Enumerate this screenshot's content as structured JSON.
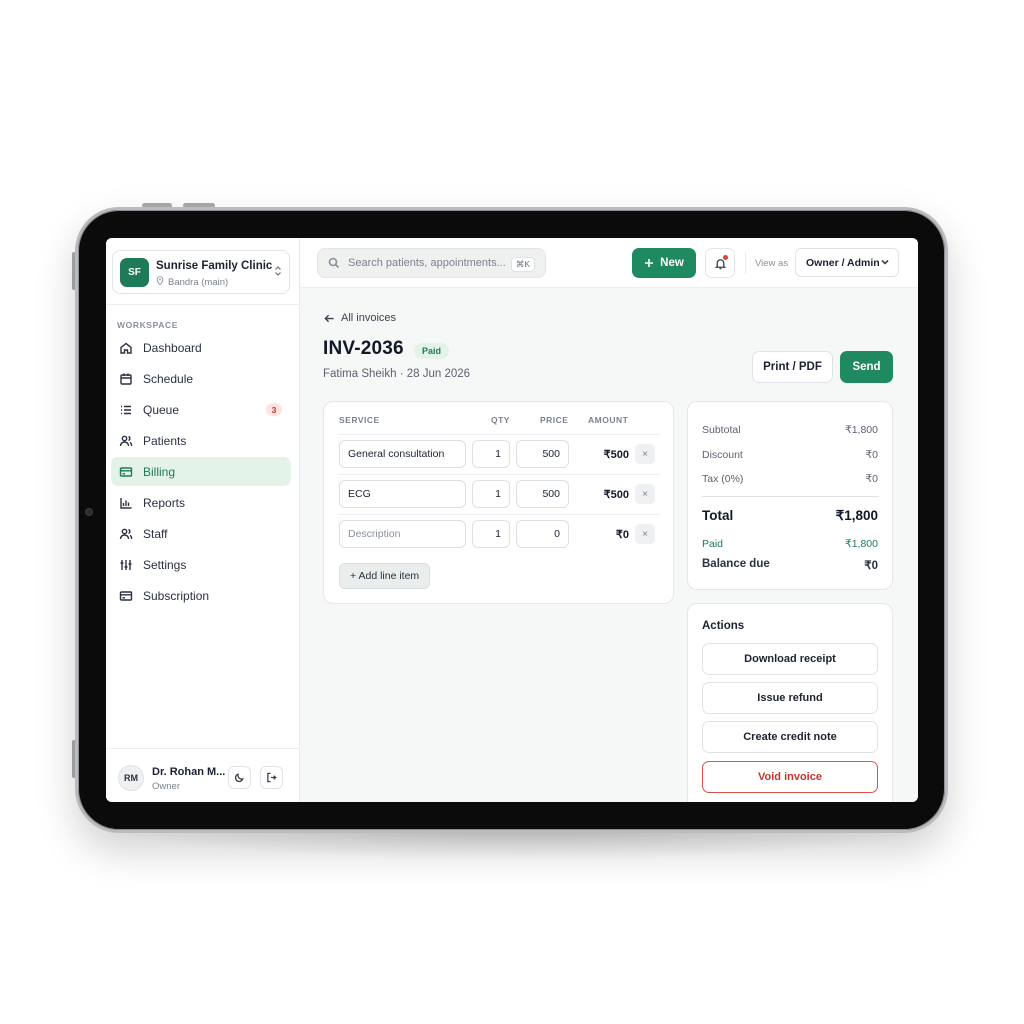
{
  "org": {
    "initials": "SF",
    "name": "Sunrise Family Clinic",
    "location": "Bandra (main)"
  },
  "sidebar": {
    "section_label": "WORKSPACE",
    "items": [
      {
        "label": "Dashboard",
        "icon": "home-icon"
      },
      {
        "label": "Schedule",
        "icon": "calendar-icon"
      },
      {
        "label": "Queue",
        "icon": "list-icon",
        "badge": "3"
      },
      {
        "label": "Patients",
        "icon": "users-icon"
      },
      {
        "label": "Billing",
        "icon": "credit-card-icon",
        "active": true
      },
      {
        "label": "Reports",
        "icon": "bar-chart-icon"
      },
      {
        "label": "Staff",
        "icon": "user-group-icon"
      },
      {
        "label": "Settings",
        "icon": "sliders-icon"
      },
      {
        "label": "Subscription",
        "icon": "card-icon"
      }
    ]
  },
  "user": {
    "initials": "RM",
    "name": "Dr. Rohan M...",
    "role": "Owner"
  },
  "topbar": {
    "search_placeholder": "Search patients, appointments...",
    "search_shortcut": "⌘K",
    "new_label": "New",
    "view_as_label": "View as",
    "view_as_value": "Owner / Admin"
  },
  "invoice": {
    "back_label": "All invoices",
    "number": "INV-2036",
    "status": "Paid",
    "subtitle": "Fatima Sheikh · 28 Jun 2026",
    "print_label": "Print / PDF",
    "send_label": "Send",
    "columns": {
      "service": "SERVICE",
      "qty": "QTY",
      "price": "PRICE",
      "amount": "AMOUNT"
    },
    "lines": [
      {
        "service": "General consultation",
        "qty": "1",
        "price": "500",
        "amount": "₹500"
      },
      {
        "service": "ECG",
        "qty": "1",
        "price": "500",
        "amount": "₹500"
      },
      {
        "service_placeholder": "Description",
        "qty": "1",
        "price": "0",
        "amount": "₹0"
      }
    ],
    "add_line_label": "+ Add line item",
    "remove_glyph": "×"
  },
  "totals": {
    "subtotal_label": "Subtotal",
    "subtotal": "₹1,800",
    "discount_label": "Discount",
    "discount": "₹0",
    "tax_label": "Tax (0%)",
    "tax": "₹0",
    "total_label": "Total",
    "total": "₹1,800",
    "paid_label": "Paid",
    "paid": "₹1,800",
    "balance_label": "Balance due",
    "balance": "₹0"
  },
  "actions": {
    "title": "Actions",
    "download_receipt": "Download receipt",
    "issue_refund": "Issue refund",
    "create_credit_note": "Create credit note",
    "void_invoice": "Void invoice"
  },
  "colors": {
    "brand": "#1f8a5f",
    "active_bg": "#e4f3ea",
    "danger": "#c2362d"
  }
}
